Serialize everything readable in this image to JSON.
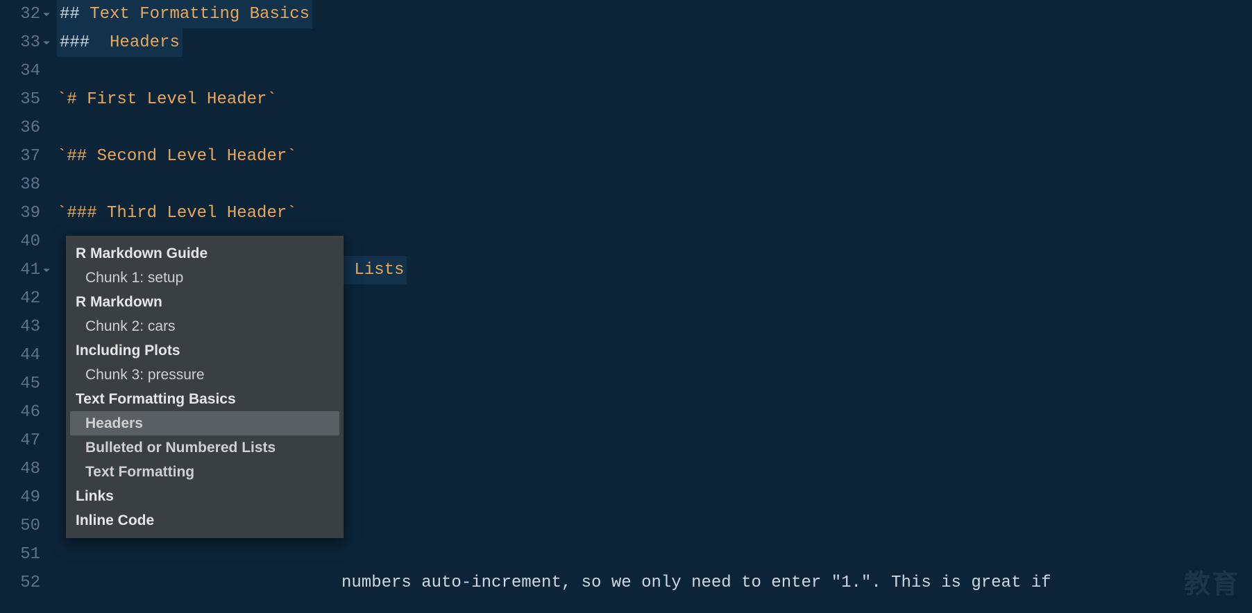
{
  "editor": {
    "lines": [
      {
        "n": 32,
        "fold": true,
        "style": "heading",
        "pound": "##",
        "space": " ",
        "text": "Text Formatting Basics"
      },
      {
        "n": 33,
        "fold": true,
        "style": "heading3",
        "pound": "###",
        "space": "  ",
        "text": "Headers"
      },
      {
        "n": 34,
        "fold": false,
        "style": "blank",
        "text": ""
      },
      {
        "n": 35,
        "fold": false,
        "style": "code",
        "text": "`# First Level Header`"
      },
      {
        "n": 36,
        "fold": false,
        "style": "blank",
        "text": ""
      },
      {
        "n": 37,
        "fold": false,
        "style": "code",
        "text": "`## Second Level Header`"
      },
      {
        "n": 38,
        "fold": false,
        "style": "blank",
        "text": ""
      },
      {
        "n": 39,
        "fold": false,
        "style": "code",
        "text": "`### Third Level Header`"
      },
      {
        "n": 40,
        "fold": false,
        "style": "blank",
        "text": ""
      },
      {
        "n": 41,
        "fold": true,
        "style": "partial",
        "tail": " Lists"
      },
      {
        "n": 42,
        "fold": false,
        "style": "blank",
        "text": ""
      },
      {
        "n": 43,
        "fold": false,
        "style": "blank",
        "text": ""
      },
      {
        "n": 44,
        "fold": false,
        "style": "blank",
        "text": ""
      },
      {
        "n": 45,
        "fold": false,
        "style": "blank",
        "text": ""
      },
      {
        "n": 46,
        "fold": false,
        "style": "blank",
        "text": ""
      },
      {
        "n": 47,
        "fold": false,
        "style": "blank",
        "text": ""
      },
      {
        "n": 48,
        "fold": false,
        "style": "blank",
        "text": ""
      },
      {
        "n": 49,
        "fold": false,
        "style": "blank",
        "text": ""
      },
      {
        "n": 50,
        "fold": false,
        "style": "blank",
        "text": ""
      },
      {
        "n": 51,
        "fold": false,
        "style": "blank",
        "text": ""
      },
      {
        "n": 52,
        "fold": false,
        "style": "wrap",
        "text": "numbers auto-increment, so we only need to enter \"1.\". This is great if"
      }
    ]
  },
  "outline": {
    "items": [
      {
        "label": "R Markdown Guide",
        "level": 0,
        "bold": true,
        "selected": false
      },
      {
        "label": "Chunk 1: setup",
        "level": 1,
        "bold": false,
        "selected": false
      },
      {
        "label": "R Markdown",
        "level": 0,
        "bold": true,
        "selected": false
      },
      {
        "label": "Chunk 2: cars",
        "level": 1,
        "bold": false,
        "selected": false
      },
      {
        "label": "Including Plots",
        "level": 0,
        "bold": true,
        "selected": false
      },
      {
        "label": "Chunk 3: pressure",
        "level": 1,
        "bold": false,
        "selected": false
      },
      {
        "label": "Text Formatting Basics",
        "level": 0,
        "bold": true,
        "selected": false
      },
      {
        "label": "Headers",
        "level": 1,
        "bold": true,
        "selected": true
      },
      {
        "label": "Bulleted or Numbered Lists",
        "level": 1,
        "bold": true,
        "selected": false
      },
      {
        "label": "Text Formatting",
        "level": 1,
        "bold": true,
        "selected": false
      },
      {
        "label": "Links",
        "level": 0,
        "bold": true,
        "selected": false
      },
      {
        "label": "Inline Code",
        "level": 0,
        "bold": true,
        "selected": false
      }
    ]
  },
  "watermark": "教育"
}
